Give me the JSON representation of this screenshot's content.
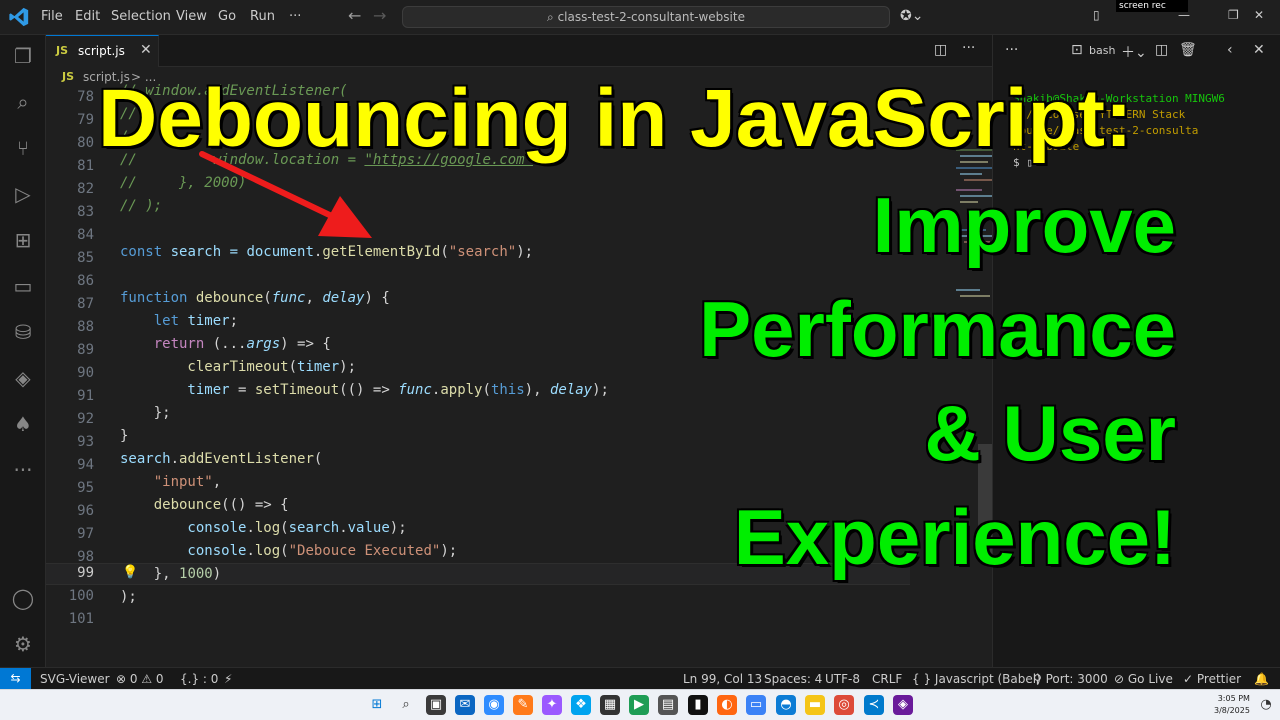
{
  "menu": [
    "File",
    "Edit",
    "Selection",
    "View",
    "Go",
    "Run",
    "···"
  ],
  "command_center": "class-test-2-consultant-website",
  "screenrec_badge": "screen rec",
  "tab": {
    "badge": "JS",
    "label": "script.js"
  },
  "breadcrumb": {
    "badge": "JS",
    "file": "script.js",
    "sep": "> ..."
  },
  "editor": {
    "line_numbers": [
      "78",
      "79",
      "80",
      "81",
      "82",
      "83",
      "84",
      "85",
      "86",
      "87",
      "88",
      "89",
      "90",
      "91",
      "92",
      "93",
      "94",
      "95",
      "96",
      "97",
      "98",
      "99",
      "100",
      "101"
    ],
    "active_line": "99",
    "code": {
      "l78": "// window.addEventListener(",
      "l79": "//",
      "l80": "//",
      "l81_a": "//         window.location = ",
      "l81_b": "\"https://google.com\"",
      "l82": "//     }, 2000)",
      "l83": "// );",
      "l85_kw": "const",
      "l85_var": " search = ",
      "l85_obj": "document",
      "l85_dot": ".",
      "l85_fn": "getElementById",
      "l85_open": "(",
      "l85_str": "\"search\"",
      "l85_close": ");",
      "l87_kw": "function",
      "l87_fn": " debounce",
      "l87_open": "(",
      "l87_p1": "func",
      "l87_comma": ", ",
      "l87_p2": "delay",
      "l87_close": ") {",
      "l88_kw": "    let",
      "l88_var": " timer",
      "l88_end": ";",
      "l89_kw": "    return",
      "l89_a": " (...",
      "l89_p": "args",
      "l89_b": ") => {",
      "l90_fn": "        clearTimeout",
      "l90_a": "(",
      "l90_v": "timer",
      "l90_b": ");",
      "l91_v": "        timer",
      "l91_a": " = ",
      "l91_fn": "setTimeout",
      "l91_b": "(() => ",
      "l91_p": "func",
      "l91_c": ".",
      "l91_fn2": "apply",
      "l91_d": "(",
      "l91_this": "this",
      "l91_e": "), ",
      "l91_p2": "delay",
      "l91_f": ");",
      "l92": "    };",
      "l93": "}",
      "l94_v": "search",
      "l94_a": ".",
      "l94_fn": "addEventListener",
      "l94_b": "(",
      "l95_str": "    \"input\"",
      "l95_a": ",",
      "l96_fn": "    debounce",
      "l96_a": "(() => {",
      "l97_v": "        console",
      "l97_a": ".",
      "l97_fn": "log",
      "l97_b": "(",
      "l97_v2": "search",
      "l97_c": ".",
      "l97_v3": "value",
      "l97_d": ");",
      "l98_v": "        console",
      "l98_a": ".",
      "l98_fn": "log",
      "l98_b": "(",
      "l98_str": "\"Debouce Executed\"",
      "l98_c": ");",
      "l99_a": "    }, ",
      "l99_num": "1000",
      "l99_b": ")",
      "l100": ");"
    }
  },
  "terminal": {
    "shell_label": "bash",
    "lines": [
      {
        "text": "Shakib@Shakib-Workstation MINGW6",
        "color": "#16c60c"
      },
      {
        "text": "4 /c/Courses/YT-MERN Stack",
        "color": "#c19c00"
      },
      {
        "text": "Course/class-test-2-consulta",
        "color": "#c19c00"
      },
      {
        "text": "nt-website",
        "color": "#c19c00"
      },
      {
        "text": "$ ▯",
        "color": "#cccccc"
      }
    ]
  },
  "overlay": {
    "title": "Debouncing in JavaScript:",
    "subtitle_lines": [
      "Improve",
      "Performance",
      "& User",
      "Experience!"
    ],
    "title_color": "#ffff00",
    "subtitle_color": "#00ee00"
  },
  "statusbar": {
    "remote": "⇆",
    "svg_viewer": "SVG-Viewer",
    "problems": "⊗ 0 ⚠ 0",
    "braces": "{.} : 0",
    "position": "Ln 99, Col 13",
    "spaces": "Spaces: 4",
    "encoding": "UTF-8",
    "eol": "CRLF",
    "language": "{ } Javascript (Babel)",
    "port": "Port: 3000",
    "golive": "Go Live",
    "prettier": "✓ Prettier"
  },
  "taskbar": {
    "time": "3:05 PM",
    "date": "3/8/2025"
  }
}
